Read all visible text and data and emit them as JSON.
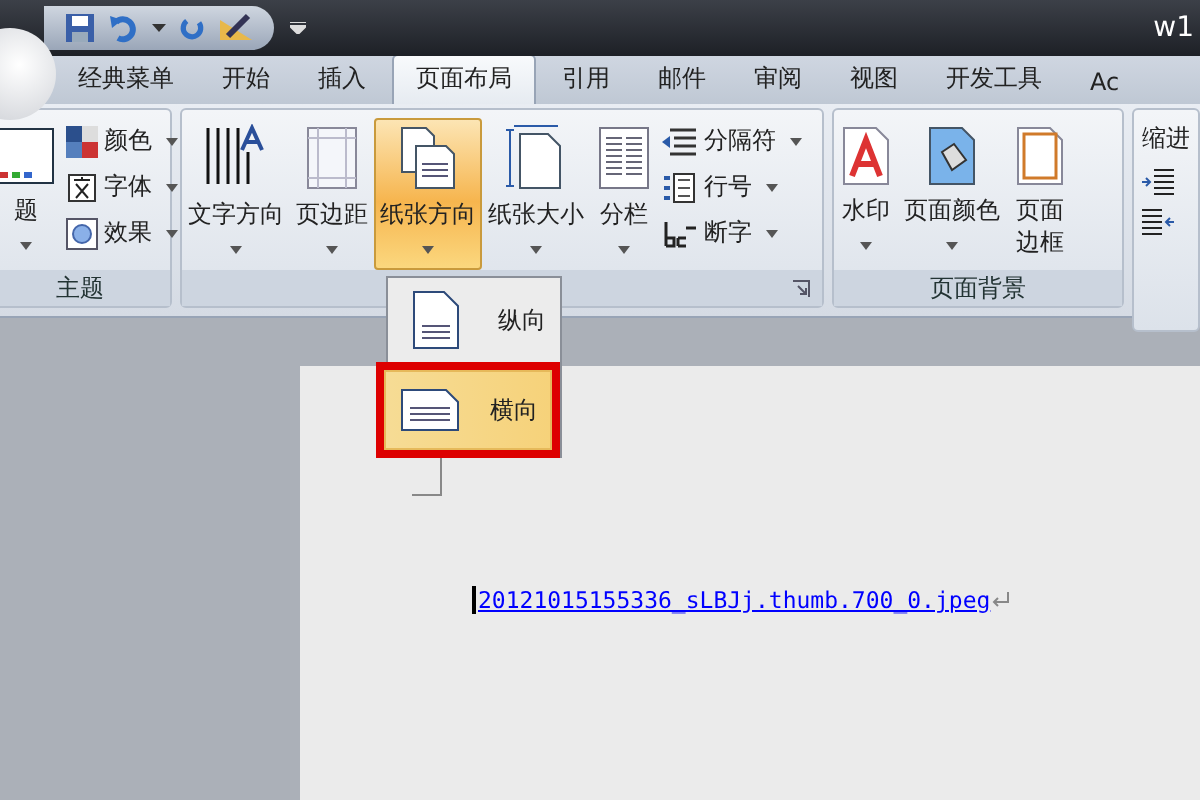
{
  "window": {
    "title": "w1"
  },
  "tabs": [
    {
      "label": "经典菜单",
      "selected": false
    },
    {
      "label": "开始",
      "selected": false
    },
    {
      "label": "插入",
      "selected": false
    },
    {
      "label": "页面布局",
      "selected": true
    },
    {
      "label": "引用",
      "selected": false
    },
    {
      "label": "邮件",
      "selected": false
    },
    {
      "label": "审阅",
      "selected": false
    },
    {
      "label": "视图",
      "selected": false
    },
    {
      "label": "开发工具",
      "selected": false
    },
    {
      "label": "Ac",
      "selected": false
    }
  ],
  "themes_group": {
    "label": "主题",
    "big_button": "题",
    "small_buttons": [
      "颜色",
      "字体",
      "效果"
    ]
  },
  "page_setup_group": {
    "big_buttons": [
      {
        "label": "文字方向",
        "kind": "textdir",
        "pressed": false
      },
      {
        "label": "页边距",
        "kind": "margins",
        "pressed": false
      },
      {
        "label": "纸张方向",
        "kind": "orientation",
        "pressed": true
      },
      {
        "label": "纸张大小",
        "kind": "size",
        "pressed": false
      },
      {
        "label": "分栏",
        "kind": "columns",
        "pressed": false
      }
    ],
    "small_buttons": [
      {
        "label": "分隔符",
        "kind": "breaks"
      },
      {
        "label": "行号",
        "kind": "linenum"
      },
      {
        "label": "断字",
        "kind": "hyphen"
      }
    ]
  },
  "page_background_group": {
    "label": "页面背景",
    "buttons": [
      {
        "label": "水印",
        "kind": "watermark",
        "caret": true
      },
      {
        "label": "页面颜色",
        "kind": "color",
        "caret": true
      },
      {
        "label": "页面边框",
        "kind": "border",
        "caret": false
      }
    ]
  },
  "paragraph_group": {
    "label": "缩进"
  },
  "orientation_menu": [
    {
      "label": "纵向",
      "selected": false
    },
    {
      "label": "横向",
      "selected": true
    }
  ],
  "document": {
    "link": "20121015155336_sLBJj.thumb.700_0.jpeg"
  }
}
